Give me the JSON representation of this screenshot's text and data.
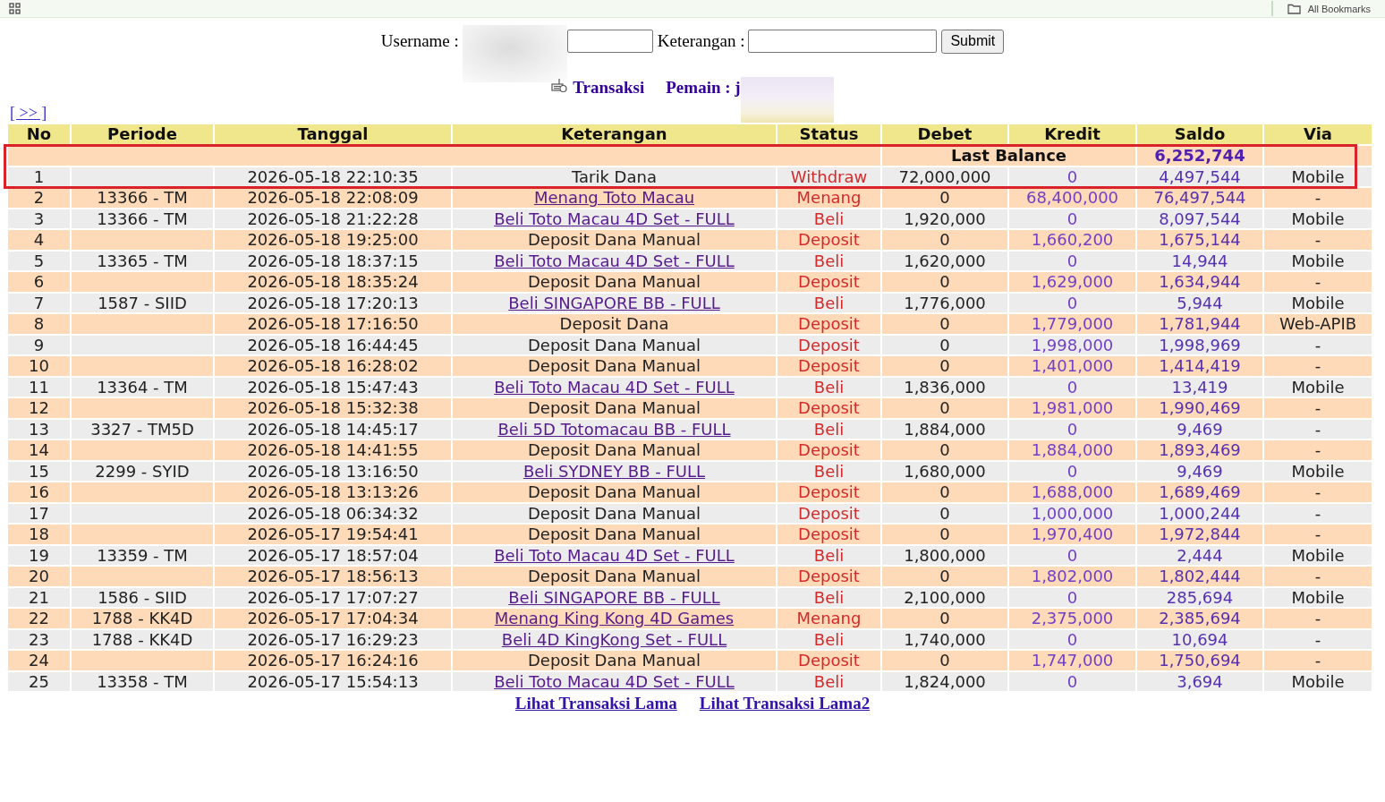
{
  "bookmarks_bar": {
    "label": "All Bookmarks"
  },
  "form": {
    "fields": [
      {
        "label": "Username :",
        "redacted": true
      },
      {
        "label": "Keterangan :",
        "redacted": false
      }
    ],
    "submit": "Submit"
  },
  "heading": {
    "title": "Transaksi",
    "player": "Pemain : j",
    "player_redacted": true
  },
  "nav_link": "[ >> ]",
  "table": {
    "columns": [
      "No",
      "Periode",
      "Tanggal",
      "Keterangan",
      "Status",
      "Debet",
      "Kredit",
      "Saldo",
      "Via"
    ],
    "last_balance": {
      "label": "Last Balance",
      "saldo": "6,252,744",
      "highlighted": true
    },
    "rows": [
      {
        "no": "1",
        "tanggal": "2026-05-18 22:10:35",
        "keterangan": "Tarik Dana",
        "link": false,
        "status": "Withdraw",
        "debet": "72,000,000",
        "kredit": "0",
        "saldo": "4,497,544",
        "via": "Mobile",
        "highlighted": true
      },
      {
        "no": "2",
        "periode": "13366 - TM",
        "tanggal": "2026-05-18 22:08:09",
        "keterangan": "Menang Toto Macau",
        "link": true,
        "status": "Menang",
        "debet": "0",
        "kredit": "68,400,000",
        "saldo": "76,497,544",
        "via": "-",
        "highlighted": false
      },
      {
        "no": "3",
        "periode": "13366 - TM",
        "tanggal": "2026-05-18 21:22:28",
        "keterangan": "Beli Toto Macau 4D Set - FULL",
        "link": true,
        "status": "Beli",
        "debet": "1,920,000",
        "kredit": "0",
        "saldo": "8,097,544",
        "via": "Mobile",
        "highlighted": false
      },
      {
        "no": "4",
        "tanggal": "2026-05-18 19:25:00",
        "keterangan": "Deposit Dana Manual",
        "link": false,
        "status": "Deposit",
        "debet": "0",
        "kredit": "1,660,200",
        "saldo": "1,675,144",
        "via": "-",
        "highlighted": false
      },
      {
        "no": "5",
        "periode": "13365 - TM",
        "tanggal": "2026-05-18 18:37:15",
        "keterangan": "Beli Toto Macau 4D Set - FULL",
        "link": true,
        "status": "Beli",
        "debet": "1,620,000",
        "kredit": "0",
        "saldo": "14,944",
        "via": "Mobile",
        "highlighted": false
      },
      {
        "no": "6",
        "tanggal": "2026-05-18 18:35:24",
        "keterangan": "Deposit Dana Manual",
        "link": false,
        "status": "Deposit",
        "debet": "0",
        "kredit": "1,629,000",
        "saldo": "1,634,944",
        "via": "-",
        "highlighted": false
      },
      {
        "no": "7",
        "periode": "1587 - SIID",
        "tanggal": "2026-05-18 17:20:13",
        "keterangan": "Beli SINGAPORE BB - FULL",
        "link": true,
        "status": "Beli",
        "debet": "1,776,000",
        "kredit": "0",
        "saldo": "5,944",
        "via": "Mobile",
        "highlighted": false
      },
      {
        "no": "8",
        "tanggal": "2026-05-18 17:16:50",
        "keterangan": "Deposit Dana",
        "link": false,
        "status": "Deposit",
        "debet": "0",
        "kredit": "1,779,000",
        "saldo": "1,781,944",
        "via": "Web-APIB",
        "highlighted": false
      },
      {
        "no": "9",
        "tanggal": "2026-05-18 16:44:45",
        "keterangan": "Deposit Dana Manual",
        "link": false,
        "status": "Deposit",
        "debet": "0",
        "kredit": "1,998,000",
        "saldo": "1,998,969",
        "via": "-",
        "highlighted": false
      },
      {
        "no": "10",
        "tanggal": "2026-05-18 16:28:02",
        "keterangan": "Deposit Dana Manual",
        "link": false,
        "status": "Deposit",
        "debet": "0",
        "kredit": "1,401,000",
        "saldo": "1,414,419",
        "via": "-",
        "highlighted": false
      },
      {
        "no": "11",
        "periode": "13364 - TM",
        "tanggal": "2026-05-18 15:47:43",
        "keterangan": "Beli Toto Macau 4D Set - FULL",
        "link": true,
        "status": "Beli",
        "debet": "1,836,000",
        "kredit": "0",
        "saldo": "13,419",
        "via": "Mobile",
        "highlighted": false
      },
      {
        "no": "12",
        "tanggal": "2026-05-18 15:32:38",
        "keterangan": "Deposit Dana Manual",
        "link": false,
        "status": "Deposit",
        "debet": "0",
        "kredit": "1,981,000",
        "saldo": "1,990,469",
        "via": "-",
        "highlighted": false
      },
      {
        "no": "13",
        "periode": "3327 - TM5D",
        "tanggal": "2026-05-18 14:45:17",
        "keterangan": "Beli 5D Totomacau BB - FULL",
        "link": true,
        "status": "Beli",
        "debet": "1,884,000",
        "kredit": "0",
        "saldo": "9,469",
        "via": "-",
        "highlighted": false
      },
      {
        "no": "14",
        "tanggal": "2026-05-18 14:41:55",
        "keterangan": "Deposit Dana Manual",
        "link": false,
        "status": "Deposit",
        "debet": "0",
        "kredit": "1,884,000",
        "saldo": "1,893,469",
        "via": "-",
        "highlighted": false
      },
      {
        "no": "15",
        "periode": "2299 - SYID",
        "tanggal": "2026-05-18 13:16:50",
        "keterangan": "Beli SYDNEY BB - FULL",
        "link": true,
        "status": "Beli",
        "debet": "1,680,000",
        "kredit": "0",
        "saldo": "9,469",
        "via": "Mobile",
        "highlighted": false
      },
      {
        "no": "16",
        "tanggal": "2026-05-18 13:13:26",
        "keterangan": "Deposit Dana Manual",
        "link": false,
        "status": "Deposit",
        "debet": "0",
        "kredit": "1,688,000",
        "saldo": "1,689,469",
        "via": "-",
        "highlighted": false
      },
      {
        "no": "17",
        "tanggal": "2026-05-18 06:34:32",
        "keterangan": "Deposit Dana Manual",
        "link": false,
        "status": "Deposit",
        "debet": "0",
        "kredit": "1,000,000",
        "saldo": "1,000,244",
        "via": "-",
        "highlighted": false
      },
      {
        "no": "18",
        "tanggal": "2026-05-17 19:54:41",
        "keterangan": "Deposit Dana Manual",
        "link": false,
        "status": "Deposit",
        "debet": "0",
        "kredit": "1,970,400",
        "saldo": "1,972,844",
        "via": "-",
        "highlighted": false
      },
      {
        "no": "19",
        "periode": "13359 - TM",
        "tanggal": "2026-05-17 18:57:04",
        "keterangan": "Beli Toto Macau 4D Set - FULL",
        "link": true,
        "status": "Beli",
        "debet": "1,800,000",
        "kredit": "0",
        "saldo": "2,444",
        "via": "Mobile",
        "highlighted": false
      },
      {
        "no": "20",
        "tanggal": "2026-05-17 18:56:13",
        "keterangan": "Deposit Dana Manual",
        "link": false,
        "status": "Deposit",
        "debet": "0",
        "kredit": "1,802,000",
        "saldo": "1,802,444",
        "via": "-",
        "highlighted": false
      },
      {
        "no": "21",
        "periode": "1586 - SIID",
        "tanggal": "2026-05-17 17:07:27",
        "keterangan": "Beli SINGAPORE BB - FULL",
        "link": true,
        "status": "Beli",
        "debet": "2,100,000",
        "kredit": "0",
        "saldo": "285,694",
        "via": "Mobile",
        "highlighted": false
      },
      {
        "no": "22",
        "periode": "1788 - KK4D",
        "tanggal": "2026-05-17 17:04:34",
        "keterangan": "Menang King Kong 4D Games",
        "link": true,
        "status": "Menang",
        "debet": "0",
        "kredit": "2,375,000",
        "saldo": "2,385,694",
        "via": "-",
        "highlighted": false
      },
      {
        "no": "23",
        "periode": "1788 - KK4D",
        "tanggal": "2026-05-17 16:29:23",
        "keterangan": "Beli 4D KingKong Set - FULL",
        "link": true,
        "status": "Beli",
        "debet": "1,740,000",
        "kredit": "0",
        "saldo": "10,694",
        "via": "-",
        "highlighted": false
      },
      {
        "no": "24",
        "tanggal": "2026-05-17 16:24:16",
        "keterangan": "Deposit Dana Manual",
        "link": false,
        "status": "Deposit",
        "debet": "0",
        "kredit": "1,747,000",
        "saldo": "1,750,694",
        "via": "-",
        "highlighted": false
      },
      {
        "no": "25",
        "periode": "13358 - TM",
        "tanggal": "2026-05-17 15:54:13",
        "keterangan": "Beli Toto Macau 4D Set - FULL",
        "link": true,
        "status": "Beli",
        "debet": "1,824,000",
        "kredit": "0",
        "saldo": "3,694",
        "via": "Mobile",
        "highlighted": false
      }
    ]
  },
  "footer_links": [
    "Lihat Transaksi Lama",
    "Lihat Transaksi Lama2"
  ]
}
